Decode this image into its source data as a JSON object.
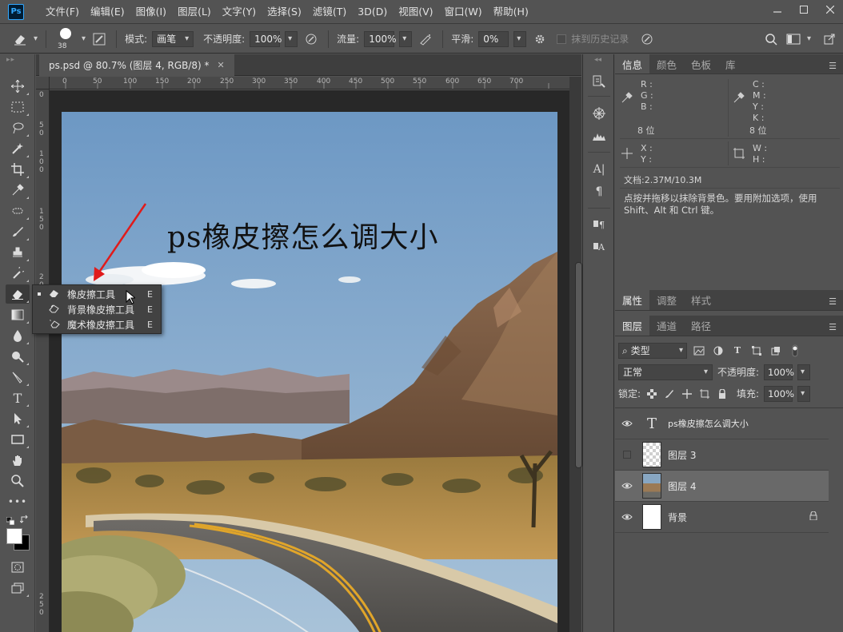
{
  "app": {
    "logo": "Ps",
    "menu": [
      "文件(F)",
      "编辑(E)",
      "图像(I)",
      "图层(L)",
      "文字(Y)",
      "选择(S)",
      "滤镜(T)",
      "3D(D)",
      "视图(V)",
      "窗口(W)",
      "帮助(H)"
    ]
  },
  "options": {
    "brush_size": "38",
    "mode_label": "模式:",
    "mode_value": "画笔",
    "opacity_label": "不透明度:",
    "opacity_value": "100%",
    "flow_label": "流量:",
    "flow_value": "100%",
    "smooth_label": "平滑:",
    "smooth_value": "0%",
    "history_label": "抹到历史记录"
  },
  "document": {
    "tab_title": "ps.psd @ 80.7% (图层 4, RGB/8) *",
    "ruler_h": [
      "0",
      "50",
      "100",
      "150",
      "200",
      "250",
      "300",
      "350",
      "400",
      "450",
      "500",
      "550",
      "600",
      "650",
      "700"
    ],
    "ruler_v": [
      "0",
      "5",
      "0",
      "1",
      "0",
      "0",
      "1",
      "5",
      "0",
      "2",
      "0",
      "0",
      "2",
      "5",
      "0"
    ],
    "canvas_text": "ps橡皮擦怎么调大小"
  },
  "flyout": {
    "items": [
      {
        "label": "橡皮擦工具",
        "key": "E",
        "icon": "eraser-icon"
      },
      {
        "label": "背景橡皮擦工具",
        "key": "E",
        "icon": "background-eraser-icon"
      },
      {
        "label": "魔术橡皮擦工具",
        "key": "E",
        "icon": "magic-eraser-icon"
      }
    ]
  },
  "info_panel": {
    "tabs": [
      "信息",
      "颜色",
      "色板",
      "库"
    ],
    "r": "R :",
    "g": "G :",
    "b": "B :",
    "c": "C :",
    "m": "M :",
    "y": "Y :",
    "k": "K :",
    "bits_left": "8 位",
    "bits_right": "8 位",
    "x": "X :",
    "yy": "Y :",
    "w": "W :",
    "h": "H :",
    "doc": "文档:2.37M/10.3M",
    "hint": "点按并拖移以抹除背景色。要用附加选项，使用 Shift、Alt 和 Ctrl 键。"
  },
  "props_tabs": [
    "属性",
    "调整",
    "样式"
  ],
  "layers_panel": {
    "tabs": [
      "图层",
      "通道",
      "路径"
    ],
    "filter_label": "类型",
    "blend_mode": "正常",
    "opacity_label": "不透明度:",
    "opacity_value": "100%",
    "lock_label": "锁定:",
    "fill_label": "填充:",
    "fill_value": "100%",
    "layers": [
      {
        "name": "ps橡皮擦怎么调大小",
        "visible": true
      },
      {
        "name": "图层 3",
        "visible": false
      },
      {
        "name": "图层 4",
        "visible": true
      },
      {
        "name": "背景",
        "visible": true
      }
    ]
  }
}
